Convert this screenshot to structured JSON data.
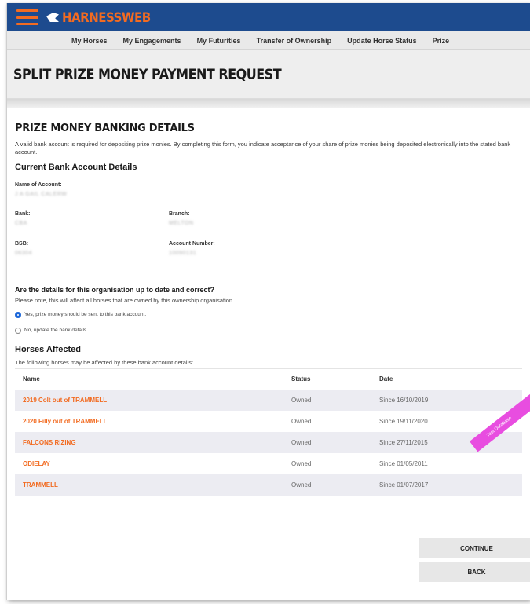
{
  "header": {
    "brand": "HARNESSWEB",
    "brand_color": "#f26b21",
    "bar_color": "#1d4b8e",
    "nav": [
      "My Horses",
      "My Engagements",
      "My Futurities",
      "Transfer of Ownership",
      "Update Horse Status",
      "Prize"
    ]
  },
  "page_title": "SPLIT PRIZE MONEY PAYMENT REQUEST",
  "banking": {
    "title": "PRIZE MONEY BANKING DETAILS",
    "intro": "A valid bank account is required for depositing prize monies. By completing this form, you indicate acceptance of your share of prize monies being deposited electronically into the stated bank account.",
    "current_heading": "Current Bank Account Details",
    "name_of_account_label": "Name of Account:",
    "name_of_account_value": "J A GAIL CALERW",
    "bank_label": "Bank:",
    "bank_value": "CBA",
    "branch_label": "Branch:",
    "branch_value": "MELTON",
    "bsb_label": "BSB:",
    "bsb_value": "06304",
    "account_number_label": "Account Number:",
    "account_number_value": "10090131"
  },
  "confirm": {
    "question": "Are the details for this organisation up to date and correct?",
    "note": "Please note, this will affect all horses that are owned by this ownership organisation.",
    "option_yes": "Yes, prize money should be sent to this bank account.",
    "option_no": "No, update the bank details.",
    "selected": "yes"
  },
  "horses": {
    "heading": "Horses Affected",
    "note": "The following horses may be affected by these bank account details:",
    "columns": [
      "Name",
      "Status",
      "Date"
    ],
    "rows": [
      {
        "name": "2019 Colt out of TRAMMELL",
        "status": "Owned",
        "date": "Since 16/10/2019"
      },
      {
        "name": "2020 Filly out of TRAMMELL",
        "status": "Owned",
        "date": "Since 19/11/2020"
      },
      {
        "name": "FALCONS RIZING",
        "status": "Owned",
        "date": "Since 27/11/2015"
      },
      {
        "name": "ODIELAY",
        "status": "Owned",
        "date": "Since 01/05/2011"
      },
      {
        "name": "TRAMMELL",
        "status": "Owned",
        "date": "Since 01/07/2017"
      }
    ]
  },
  "ribbon": "Test Database",
  "buttons": {
    "continue": "CONTINUE",
    "back": "BACK"
  }
}
